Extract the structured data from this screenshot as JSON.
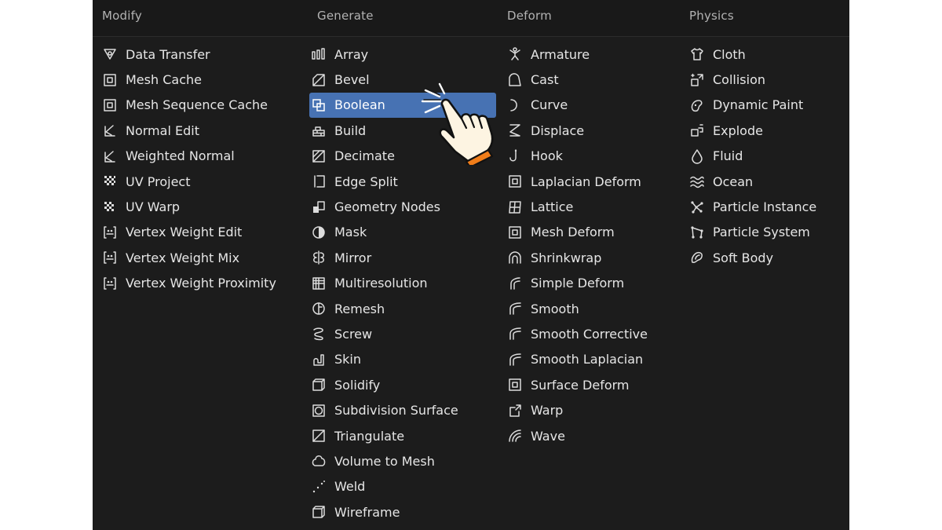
{
  "columns": [
    {
      "title": "Modify",
      "items": [
        {
          "label": "Data Transfer",
          "icon": "data-transfer-icon"
        },
        {
          "label": "Mesh Cache",
          "icon": "mesh-cache-icon"
        },
        {
          "label": "Mesh Sequence Cache",
          "icon": "mesh-sequence-cache-icon"
        },
        {
          "label": "Normal Edit",
          "icon": "normal-edit-icon"
        },
        {
          "label": "Weighted Normal",
          "icon": "weighted-normal-icon"
        },
        {
          "label": "UV Project",
          "icon": "uv-project-icon"
        },
        {
          "label": "UV Warp",
          "icon": "uv-warp-icon"
        },
        {
          "label": "Vertex Weight Edit",
          "icon": "vertex-weight-icon"
        },
        {
          "label": "Vertex Weight Mix",
          "icon": "vertex-weight-icon"
        },
        {
          "label": "Vertex Weight Proximity",
          "icon": "vertex-weight-icon"
        }
      ]
    },
    {
      "title": "Generate",
      "items": [
        {
          "label": "Array",
          "icon": "array-icon"
        },
        {
          "label": "Bevel",
          "icon": "bevel-icon"
        },
        {
          "label": "Boolean",
          "icon": "boolean-icon",
          "active": true
        },
        {
          "label": "Build",
          "icon": "build-icon"
        },
        {
          "label": "Decimate",
          "icon": "decimate-icon"
        },
        {
          "label": "Edge Split",
          "icon": "edge-split-icon"
        },
        {
          "label": "Geometry Nodes",
          "icon": "geometry-nodes-icon"
        },
        {
          "label": "Mask",
          "icon": "mask-icon"
        },
        {
          "label": "Mirror",
          "icon": "mirror-icon"
        },
        {
          "label": "Multiresolution",
          "icon": "multiresolution-icon"
        },
        {
          "label": "Remesh",
          "icon": "remesh-icon"
        },
        {
          "label": "Screw",
          "icon": "screw-icon"
        },
        {
          "label": "Skin",
          "icon": "skin-icon"
        },
        {
          "label": "Solidify",
          "icon": "solidify-icon"
        },
        {
          "label": "Subdivision Surface",
          "icon": "subdivision-surface-icon"
        },
        {
          "label": "Triangulate",
          "icon": "triangulate-icon"
        },
        {
          "label": "Volume to Mesh",
          "icon": "volume-to-mesh-icon"
        },
        {
          "label": "Weld",
          "icon": "weld-icon"
        },
        {
          "label": "Wireframe",
          "icon": "wireframe-icon"
        }
      ]
    },
    {
      "title": "Deform",
      "items": [
        {
          "label": "Armature",
          "icon": "armature-icon"
        },
        {
          "label": "Cast",
          "icon": "cast-icon"
        },
        {
          "label": "Curve",
          "icon": "curve-icon"
        },
        {
          "label": "Displace",
          "icon": "displace-icon"
        },
        {
          "label": "Hook",
          "icon": "hook-icon"
        },
        {
          "label": "Laplacian Deform",
          "icon": "laplacian-deform-icon"
        },
        {
          "label": "Lattice",
          "icon": "lattice-icon"
        },
        {
          "label": "Mesh Deform",
          "icon": "mesh-deform-icon"
        },
        {
          "label": "Shrinkwrap",
          "icon": "shrinkwrap-icon"
        },
        {
          "label": "Simple Deform",
          "icon": "simple-deform-icon"
        },
        {
          "label": "Smooth",
          "icon": "smooth-icon"
        },
        {
          "label": "Smooth Corrective",
          "icon": "smooth-icon"
        },
        {
          "label": "Smooth Laplacian",
          "icon": "smooth-icon"
        },
        {
          "label": "Surface Deform",
          "icon": "surface-deform-icon"
        },
        {
          "label": "Warp",
          "icon": "warp-icon"
        },
        {
          "label": "Wave",
          "icon": "wave-icon"
        }
      ]
    },
    {
      "title": "Physics",
      "items": [
        {
          "label": "Cloth",
          "icon": "cloth-icon"
        },
        {
          "label": "Collision",
          "icon": "collision-icon"
        },
        {
          "label": "Dynamic Paint",
          "icon": "dynamic-paint-icon"
        },
        {
          "label": "Explode",
          "icon": "explode-icon"
        },
        {
          "label": "Fluid",
          "icon": "fluid-icon"
        },
        {
          "label": "Ocean",
          "icon": "ocean-icon"
        },
        {
          "label": "Particle Instance",
          "icon": "particle-instance-icon"
        },
        {
          "label": "Particle System",
          "icon": "particle-system-icon"
        },
        {
          "label": "Soft Body",
          "icon": "soft-body-icon"
        }
      ]
    }
  ],
  "pointer_icon": "hand-pointer-icon",
  "colors": {
    "panel_bg": "#1c1c1c",
    "header_bg": "#191919",
    "text": "#e6e6e6",
    "header_text": "#b3b3b3",
    "highlight": "#4772b3",
    "pointer_cuff": "#f07d1a"
  }
}
